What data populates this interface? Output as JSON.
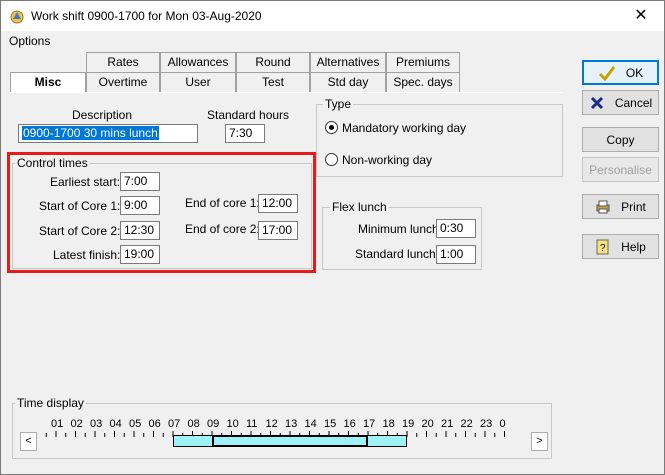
{
  "window": {
    "title": "Work shift 0900-1700 for Mon 03-Aug-2020",
    "close_glyph": "✕"
  },
  "menu": {
    "options": "Options"
  },
  "tabs": {
    "row1": [
      "Rates",
      "Allowances",
      "Round",
      "Alternatives",
      "Premiums"
    ],
    "row2": [
      "Misc",
      "Overtime",
      "User",
      "Test",
      "Std day",
      "Spec. days"
    ],
    "active": "Misc"
  },
  "description": {
    "label": "Description",
    "value": "0900-1700 30 mins lunch"
  },
  "standard_hours": {
    "label": "Standard hours",
    "value": "7:30"
  },
  "type_group": {
    "title": "Type",
    "options": [
      {
        "label": "Mandatory working day",
        "selected": true
      },
      {
        "label": "Non-working day",
        "selected": false
      }
    ]
  },
  "control_times": {
    "title": "Control times",
    "earliest_start": {
      "label": "Earliest start:",
      "value": "7:00"
    },
    "start_core_1": {
      "label": "Start of Core 1:",
      "value": "9:00"
    },
    "start_core_2": {
      "label": "Start of Core 2:",
      "value": "12:30"
    },
    "latest_finish": {
      "label": "Latest finish:",
      "value": "19:00"
    },
    "end_core_1": {
      "label": "End of core 1:",
      "value": "12:00"
    },
    "end_core_2": {
      "label": "End of core 2:",
      "value": "17:00"
    }
  },
  "flex_lunch": {
    "title": "Flex lunch",
    "minimum": {
      "label": "Minimum lunch:",
      "value": "0:30"
    },
    "standard": {
      "label": "Standard lunch:",
      "value": "1:00"
    }
  },
  "buttons": {
    "ok": "OK",
    "cancel": "Cancel",
    "copy": "Copy",
    "personalise": "Personalise",
    "print": "Print",
    "help": "Help"
  },
  "time_display": {
    "title": "Time display",
    "hours": [
      "01",
      "02",
      "03",
      "04",
      "05",
      "06",
      "07",
      "08",
      "09",
      "10",
      "11",
      "12",
      "13",
      "14",
      "15",
      "16",
      "17",
      "18",
      "19",
      "20",
      "21",
      "22",
      "23",
      "0"
    ],
    "flex_start_hour": 7,
    "core_start_hour": 9,
    "core_end_hour": 17,
    "flex_end_hour": 19
  },
  "colors": {
    "highlight_box": "#e81b1b",
    "track": "#9ff3f8"
  }
}
